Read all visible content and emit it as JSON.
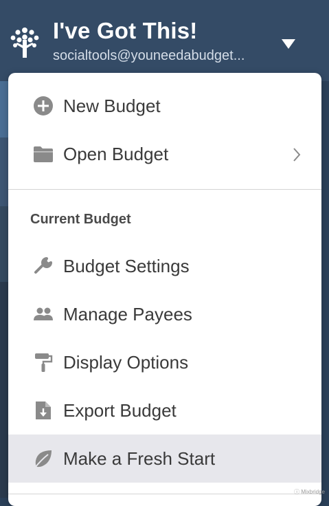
{
  "header": {
    "title": "I've Got This!",
    "email": "socialtools@youneedabudget..."
  },
  "menu": {
    "items_top": [
      {
        "label": "New Budget",
        "icon": "plus-circle-icon"
      },
      {
        "label": "Open Budget",
        "icon": "folder-icon",
        "has_submenu": true
      }
    ],
    "section_title": "Current Budget",
    "items_current": [
      {
        "label": "Budget Settings",
        "icon": "wrench-icon"
      },
      {
        "label": "Manage Payees",
        "icon": "people-icon"
      },
      {
        "label": "Display Options",
        "icon": "paint-roller-icon"
      },
      {
        "label": "Export Budget",
        "icon": "file-download-icon"
      },
      {
        "label": "Make a Fresh Start",
        "icon": "leaf-icon",
        "highlighted": true
      }
    ]
  },
  "watermark": "ⓘ Mixbridge",
  "colors": {
    "header_bg": "#344b66",
    "page_bg": "#2b4059",
    "menu_bg": "#ffffff",
    "highlight_bg": "#e7e7ec",
    "icon_color": "#8a8a8a",
    "text_color": "#3a3a3a"
  }
}
